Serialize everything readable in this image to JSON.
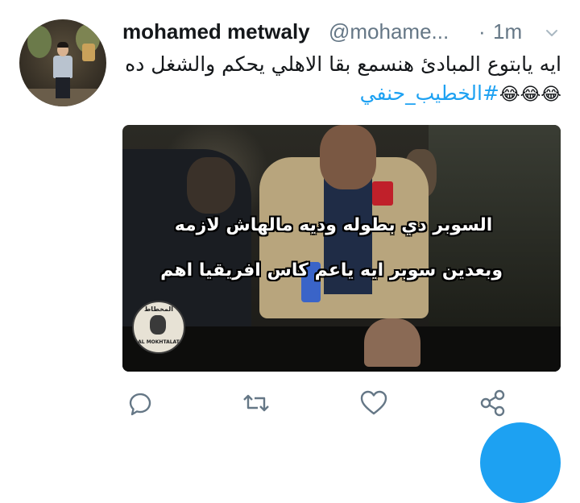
{
  "tweet": {
    "display_name": "mohamed metwaly",
    "handle": "@mohame...",
    "separator": "·",
    "time": "1m",
    "text_main": "ايه يابتوع المبادئ هنسمع بقا الاهلي يحكم والشغل ده ",
    "text_emojis": "😂😂😂",
    "hashtag": "#الخطيب_حنفي"
  },
  "media": {
    "caption_line_1": "السوبر دي بطوله وديه مالهاش لازمه",
    "caption_line_2": "وبعدين سوبر ايه ياعم كاس افريقيا اهم",
    "watermark_top": "المخطاط",
    "watermark_bottom": "AL MOKHTALAT"
  },
  "actions": [
    "reply-icon",
    "retweet-icon",
    "like-icon",
    "share-icon"
  ],
  "colors": {
    "link": "#1da1f2",
    "secondary_text": "#657786",
    "icon": "#657786",
    "fab": "#1da1f2"
  }
}
